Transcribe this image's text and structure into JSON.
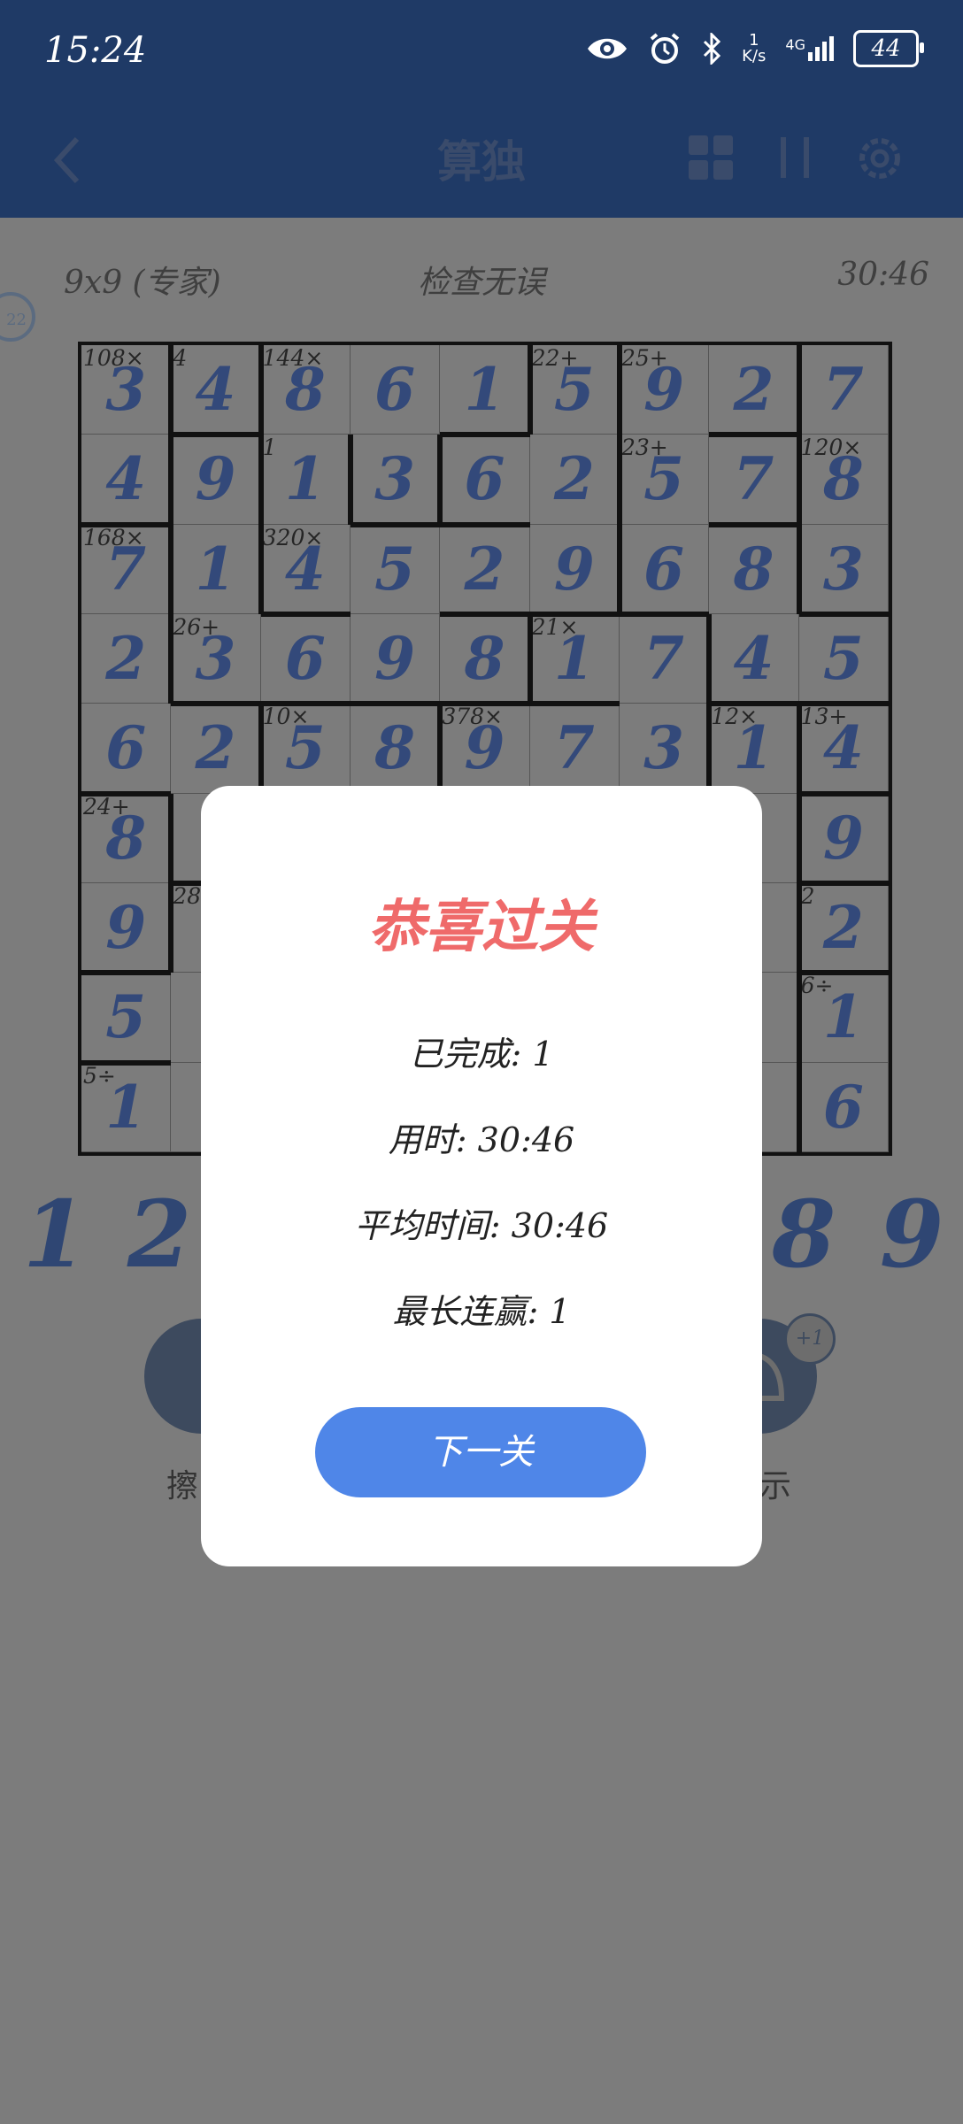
{
  "status_bar": {
    "time": "15:24",
    "net_speed_value": "1",
    "net_speed_unit": "K/s",
    "network": "4G",
    "battery": "44",
    "icons": [
      "eye-icon",
      "alarm-icon",
      "bluetooth-icon",
      "signal-icon",
      "battery-icon"
    ]
  },
  "app_bar": {
    "title": "算独",
    "icons": [
      "back-icon",
      "calculator-icon",
      "pause-icon",
      "settings-icon"
    ]
  },
  "game_info": {
    "difficulty": "9x9 (专家)",
    "status": "检查无误",
    "timer": "30:46",
    "side_badge": "22"
  },
  "grid": {
    "size": 9,
    "values": [
      [
        "3",
        "4",
        "8",
        "6",
        "1",
        "5",
        "9",
        "2",
        "7"
      ],
      [
        "4",
        "9",
        "1",
        "3",
        "6",
        "2",
        "5",
        "7",
        "8"
      ],
      [
        "7",
        "1",
        "4",
        "5",
        "2",
        "9",
        "6",
        "8",
        "3"
      ],
      [
        "2",
        "3",
        "6",
        "9",
        "8",
        "1",
        "7",
        "4",
        "5"
      ],
      [
        "6",
        "2",
        "5",
        "8",
        "9",
        "7",
        "3",
        "1",
        "4"
      ],
      [
        "8",
        "",
        "",
        "",
        "",
        "",
        "",
        "",
        "9"
      ],
      [
        "9",
        "",
        "",
        "",
        "",
        "",
        "",
        "",
        "2"
      ],
      [
        "5",
        "",
        "",
        "",
        "",
        "",
        "",
        "",
        "1"
      ],
      [
        "1",
        "",
        "",
        "",
        "",
        "",
        "",
        "",
        "6"
      ]
    ],
    "cages": [
      {
        "r": 0,
        "c": 0,
        "label": "108×"
      },
      {
        "r": 0,
        "c": 1,
        "label": "4"
      },
      {
        "r": 0,
        "c": 2,
        "label": "144×"
      },
      {
        "r": 0,
        "c": 5,
        "label": "22+"
      },
      {
        "r": 0,
        "c": 6,
        "label": "25+"
      },
      {
        "r": 1,
        "c": 2,
        "label": "1"
      },
      {
        "r": 1,
        "c": 6,
        "label": "23+"
      },
      {
        "r": 1,
        "c": 8,
        "label": "120×"
      },
      {
        "r": 2,
        "c": 0,
        "label": "168×"
      },
      {
        "r": 2,
        "c": 2,
        "label": "320×"
      },
      {
        "r": 3,
        "c": 1,
        "label": "26+"
      },
      {
        "r": 3,
        "c": 5,
        "label": "21×"
      },
      {
        "r": 4,
        "c": 2,
        "label": "10×"
      },
      {
        "r": 4,
        "c": 4,
        "label": "378×"
      },
      {
        "r": 4,
        "c": 7,
        "label": "12×"
      },
      {
        "r": 4,
        "c": 8,
        "label": "13+"
      },
      {
        "r": 5,
        "c": 0,
        "label": "24+"
      },
      {
        "r": 6,
        "c": 1,
        "label": "28"
      },
      {
        "r": 6,
        "c": 8,
        "label": "2"
      },
      {
        "r": 7,
        "c": 8,
        "label": "6÷"
      },
      {
        "r": 8,
        "c": 0,
        "label": "5÷"
      }
    ]
  },
  "numpad": [
    "1",
    "2",
    "8",
    "9"
  ],
  "tools": {
    "left_label_partial": "擦",
    "right_label_partial": "示",
    "hint_badge": "+1"
  },
  "dialog": {
    "title": "恭喜过关",
    "completed": "已完成: 1",
    "time_used": "用时: 30:46",
    "avg_time": "平均时间: 30:46",
    "longest_streak": "最长连赢: 1",
    "next_button": "下一关"
  },
  "colors": {
    "header": "#1f3a66",
    "digit": "#33497a",
    "dialog_title": "#ef6a6a",
    "button": "#4f86e8"
  }
}
